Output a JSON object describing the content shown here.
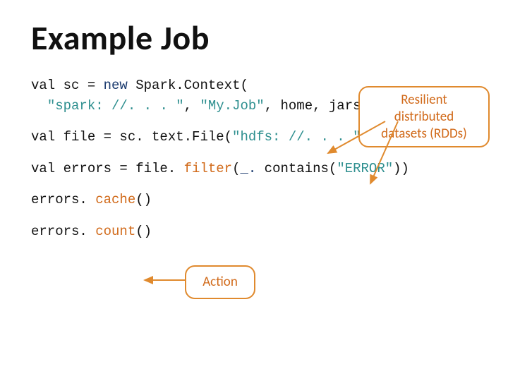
{
  "title": "Example Job",
  "code": {
    "l1a": "val sc = ",
    "l1b": "new",
    "l1c": " Spark.Context(",
    "l2a": "  ",
    "l2b": "\"spark: //. . . \"",
    "l2c": ", ",
    "l2d": "\"My.Job\"",
    "l2e": ", home, jars)",
    "l3a": "val file = sc. text.File(",
    "l3b": "\"hdfs: //. . . \"",
    "l3c": ")",
    "l4a": "val errors = file. ",
    "l4b": "filter",
    "l4c": "(",
    "l4d": "_.",
    "l4e": " contains(",
    "l4f": "\"ERROR\"",
    "l4g": "))",
    "l5a": "errors. ",
    "l5b": "cache",
    "l5c": "()",
    "l6a": "errors. ",
    "l6b": "count",
    "l6c": "()"
  },
  "callouts": {
    "rdd_l1": "Resilient distributed",
    "rdd_l2": "datasets (RDDs)",
    "action": "Action"
  }
}
